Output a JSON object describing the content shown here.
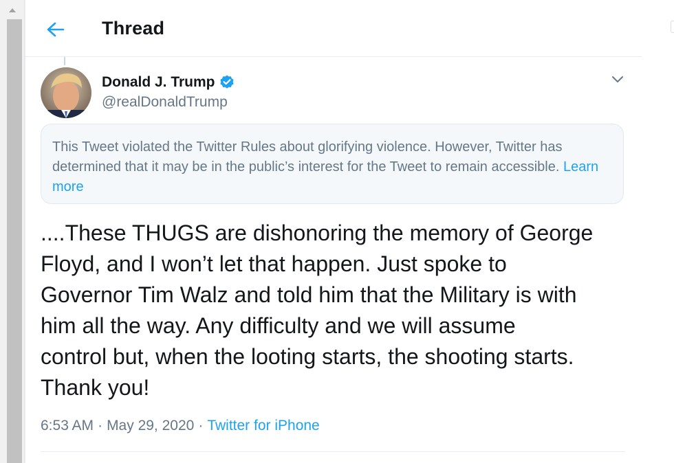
{
  "header": {
    "title": "Thread",
    "back_icon": "arrow-left-icon"
  },
  "tweet": {
    "author_name": "Donald J. Trump",
    "author_handle": "@realDonaldTrump",
    "verified_icon": "verified-badge-icon",
    "menu_icon": "chevron-down-icon",
    "notice_text": "This Tweet violated the Twitter Rules about glorifying violence. However, Twitter has determined that it may be in the public’s interest for the Tweet to remain accessible. ",
    "notice_link": "Learn more",
    "text": "....These THUGS are dishonoring the memory of George\nFloyd, and I won’t let that happen. Just spoke to\nGovernor Tim Walz and told him that the Military is with\nhim all the way. Any difficulty and we will assume\ncontrol but, when the looting starts, the shooting starts.\nThank you!",
    "time": "6:53 AM",
    "date": "May 29, 2020",
    "separator": "·",
    "source": "Twitter for iPhone"
  },
  "colors": {
    "accent": "#1da1f2",
    "secondary_text": "#657786",
    "primary_text": "#14171a",
    "notice_bg": "#f5f8fa"
  }
}
